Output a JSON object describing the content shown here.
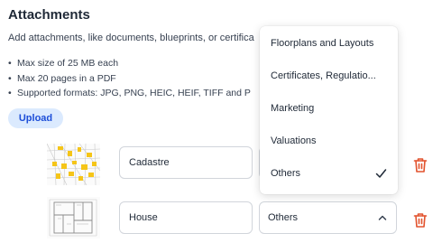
{
  "section": {
    "title": "Attachments",
    "description": "Add attachments, like documents, blueprints, or certifica",
    "rules": [
      "Max size of 25 MB each",
      "Max 20 pages in a PDF",
      "Supported formats: JPG, PNG, HEIC, HEIF, TIFF and P"
    ],
    "upload_label": "Upload"
  },
  "attachments": [
    {
      "name": "Cadastre",
      "category": ""
    },
    {
      "name": "House",
      "category": "Others"
    }
  ],
  "dropdown": {
    "options": [
      "Floorplans and Layouts",
      "Certificates, Regulatio...",
      "Marketing",
      "Valuations",
      "Others"
    ],
    "selected": "Others"
  },
  "colors": {
    "accent": "#1d4ed8",
    "accent_bg": "#dbeafe",
    "danger": "#e2532e",
    "thumb_highlight": "#f5c518"
  },
  "icons": {
    "delete": "trash-icon",
    "expand": "chevron-up-icon",
    "selected": "checkmark-icon"
  }
}
